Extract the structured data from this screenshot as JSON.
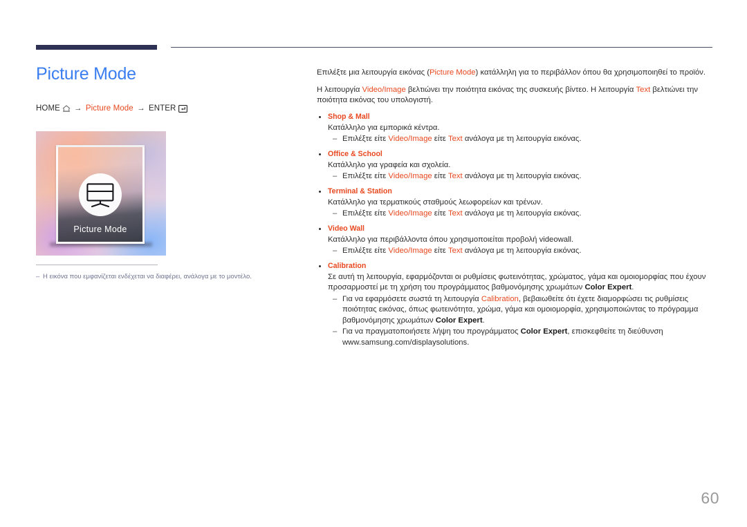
{
  "header": {
    "accent_bar_color": "#2e3153",
    "rule_color": "#4a4d66"
  },
  "left": {
    "title": "Picture Mode",
    "title_color": "#3b7ef0",
    "breadcrumb": {
      "home_label": "HOME",
      "home_icon": "home-icon",
      "arrow1": "→",
      "menu_label": "Picture Mode",
      "arrow2": "→",
      "enter_label": "ENTER",
      "enter_icon": "enter-key-icon",
      "accent_color": "#e8481f"
    },
    "thumbnail": {
      "caption": "Picture Mode",
      "icon": "monitor-display-icon"
    },
    "note": "Η εικόνα που εμφανίζεται ενδέχεται να διαφέρει, ανάλογα με το μοντέλο.",
    "note_dash": "–"
  },
  "right": {
    "intro1_a": "Επιλέξτε μια λειτουργία εικόνας (",
    "intro1_accent": "Picture Mode",
    "intro1_b": ") κατάλληλη για το περιβάλλον όπου θα χρησιμοποιηθεί το προϊόν.",
    "intro2_a": "Η λειτουργία ",
    "intro2_accent1": "Video/Image",
    "intro2_b": " βελτιώνει την ποιότητα εικόνας της συσκευής βίντεο. Η λειτουργία ",
    "intro2_accent2": "Text",
    "intro2_c": " βελτιώνει την ποιότητα εικόνας του υπολογιστή.",
    "sub_prefix": "Επιλέξτε είτε ",
    "sub_accent1": "Video/Image",
    "sub_mid": " είτε ",
    "sub_accent2": "Text",
    "sub_suffix": " ανάλογα με τη λειτουργία εικόνας.",
    "items": [
      {
        "title": "Shop & Mall",
        "body": "Κατάλληλο για εμπορικά κέντρα."
      },
      {
        "title": "Office & School",
        "body": "Κατάλληλο για γραφεία και σχολεία."
      },
      {
        "title": "Terminal & Station",
        "body": "Κατάλληλο για τερματικούς σταθμούς λεωφορείων και τρένων."
      },
      {
        "title": "Video Wall",
        "body": "Κατάλληλο για περιβάλλοντα όπου χρησιμοποιείται προβολή videowall."
      }
    ],
    "calibration": {
      "title": "Calibration",
      "body_a": "Σε αυτή τη λειτουργία, εφαρμόζονται οι ρυθμίσεις φωτεινότητας, χρώματος, γάμα και ομοιομορφίας που έχουν προσαρμοστεί με τη χρήση του προγράμματος βαθμονόμησης χρωμάτων ",
      "body_bold": "Color Expert",
      "body_b": ".",
      "sub1_a": "Για να εφαρμόσετε σωστά τη λειτουργία ",
      "sub1_accent": "Calibration",
      "sub1_b": ", βεβαιωθείτε ότι έχετε διαμορφώσει τις ρυθμίσεις ποιότητας εικόνας, όπως φωτεινότητα, χρώμα, γάμα και ομοιομορφία, χρησιμοποιώντας το πρόγραμμα βαθμονόμησης χρωμάτων ",
      "sub1_bold": "Color Expert",
      "sub1_c": ".",
      "sub2_a": "Για να πραγματοποιήσετε λήψη του προγράμματος ",
      "sub2_bold": "Color Expert",
      "sub2_b": ", επισκεφθείτε τη διεύθυνση www.samsung.com/displaysolutions."
    }
  },
  "footer": {
    "page_number": "60"
  }
}
